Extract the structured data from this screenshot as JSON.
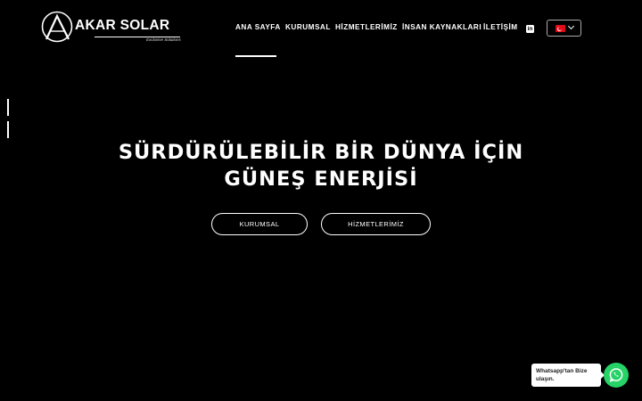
{
  "logo": {
    "name": "AKAR SOLAR",
    "tagline": "Exclusive Solutions"
  },
  "nav": {
    "items": [
      {
        "label": "ANA SAYFA",
        "active": true
      },
      {
        "label": "KURUMSAL"
      },
      {
        "label": "HİZMETLERİMİZ"
      },
      {
        "label": "İNSAN KAYNAKLARI"
      },
      {
        "label": "İLETİŞİM"
      }
    ],
    "social_icon": "linkedin-icon",
    "language_flag": "turkey-flag-icon"
  },
  "hero": {
    "title_line1": "SÜRDÜRÜLEBİLİR BİR DÜNYA İÇİN",
    "title_line2": "GÜNEŞ ENERJİSİ",
    "buttons": [
      "KURUMSAL",
      "HİZMETLERİMİZ"
    ]
  },
  "slider": {
    "slide_count": 2
  },
  "whatsapp": {
    "line1": "Whatsapp'tan Bize",
    "line2": "ulaşın.",
    "color": "#25d366"
  },
  "colors": {
    "background": "#000000",
    "text": "#ffffff"
  }
}
